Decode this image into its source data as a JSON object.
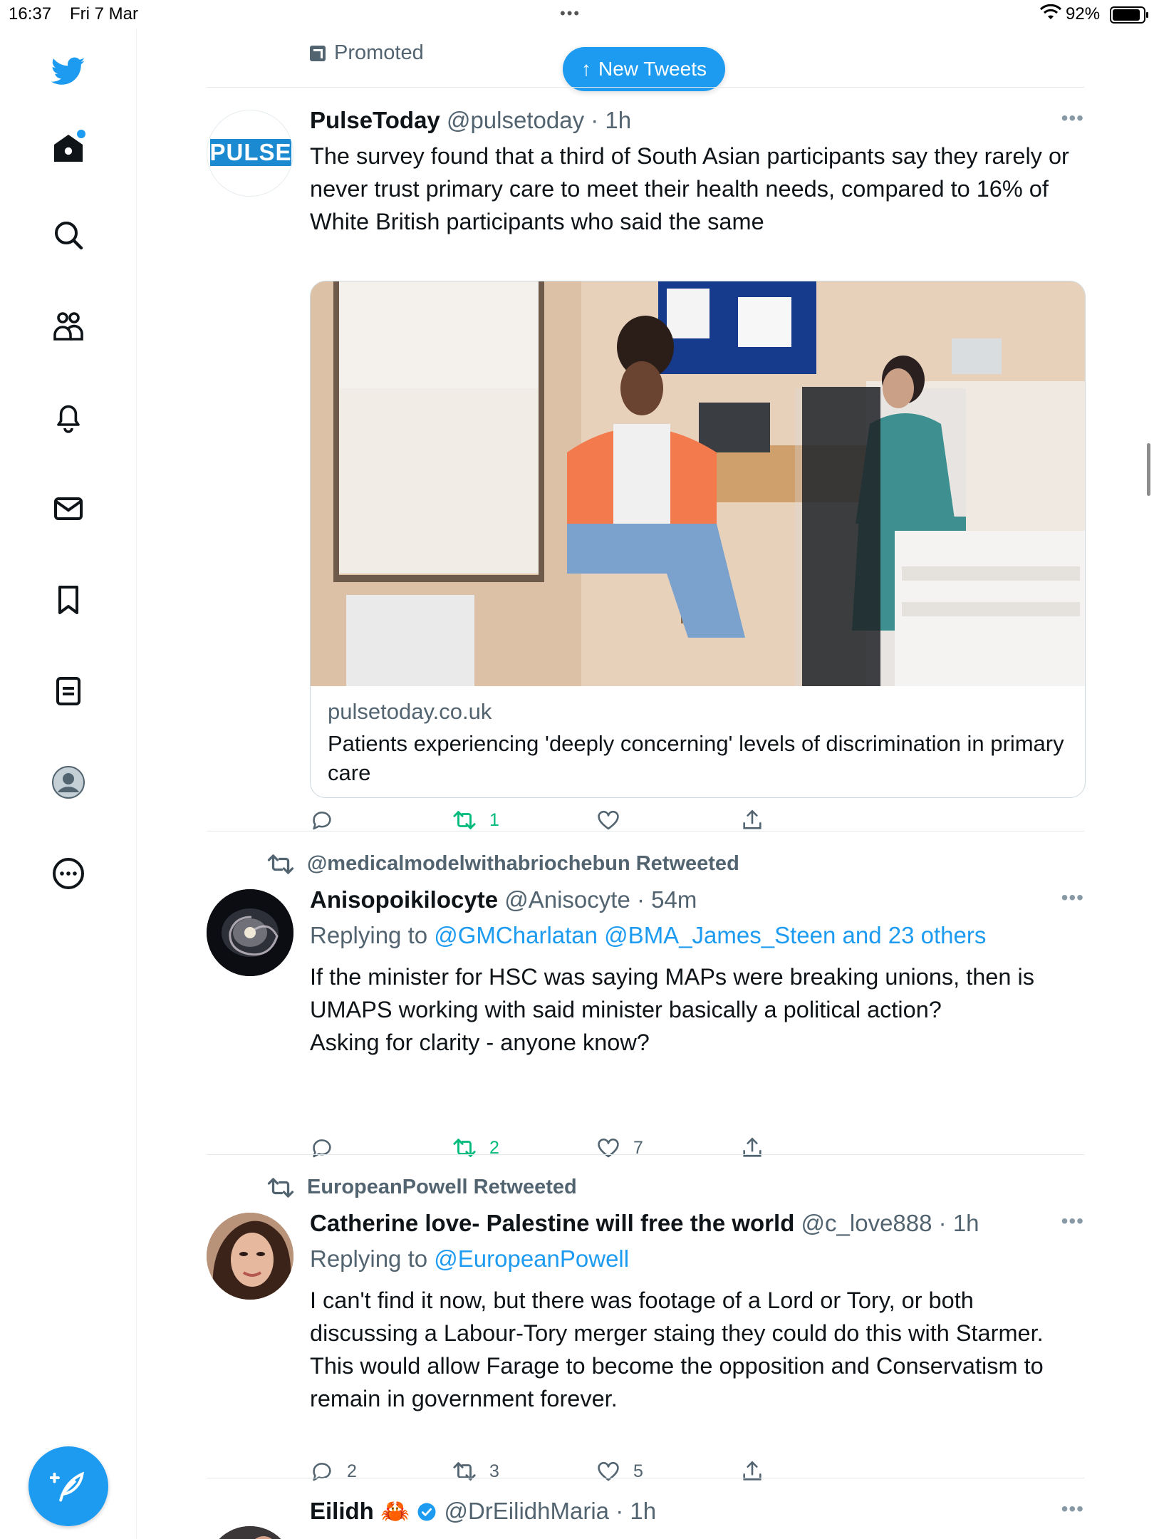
{
  "status_bar": {
    "time": "16:37",
    "date": "Fri 7 Mar",
    "battery": "92%"
  },
  "sidebar": {
    "items": [
      "twitter-logo",
      "home",
      "explore",
      "communities",
      "notifications",
      "messages",
      "bookmarks",
      "lists",
      "profile",
      "more"
    ],
    "accent": "#1d9bf0"
  },
  "feed": {
    "promoted_label": "Promoted",
    "new_tweets_label": "New Tweets",
    "tweets": [
      {
        "name": "PulseToday",
        "handle": "@pulsetoday",
        "time": "· 1h",
        "avatar_text": "PULSE",
        "text": "The survey found that a third of South Asian participants say they rarely or never trust primary care to meet their health needs, compared to 16% of White British participants who said the same",
        "card": {
          "domain": "pulsetoday.co.uk",
          "title": "Patients experiencing 'deeply concerning' levels of discrimination in primary care"
        },
        "retweets": "1",
        "likes": ""
      },
      {
        "retweeted_by": "@medicalmodelwithabriochebun Retweeted",
        "name": "Anisopoikilocyte",
        "handle": "@Anisocyte",
        "time": "· 54m",
        "replying_prefix": "Replying to ",
        "replying_to": "@GMCharlatan @BMA_James_Steen and 23 others",
        "text_p1": "If the minister for HSC was saying MAPs were breaking unions, then is UMAPS working with said minister basically a political action?",
        "text_p2": "Asking for clarity - anyone know?",
        "retweets": "2",
        "likes": "7"
      },
      {
        "retweeted_by": "EuropeanPowell Retweeted",
        "name": "Catherine love- Palestine will free the world",
        "handle": "@c_love888",
        "time": "· 1h",
        "replying_prefix": "Replying to ",
        "replying_to": "@EuropeanPowell",
        "text": "I can't find it now, but there was footage of a Lord or Tory, or both discussing a Labour-Tory merger staing they could do this with Starmer. This would allow Farage to become the opposition and Conservatism to remain in government forever.",
        "replies": "2",
        "retweets": "3",
        "likes": "5"
      },
      {
        "name": "Eilidh",
        "emoji": "🦀",
        "handle": "@DrEilidhMaria",
        "time": "· 1h"
      }
    ]
  }
}
